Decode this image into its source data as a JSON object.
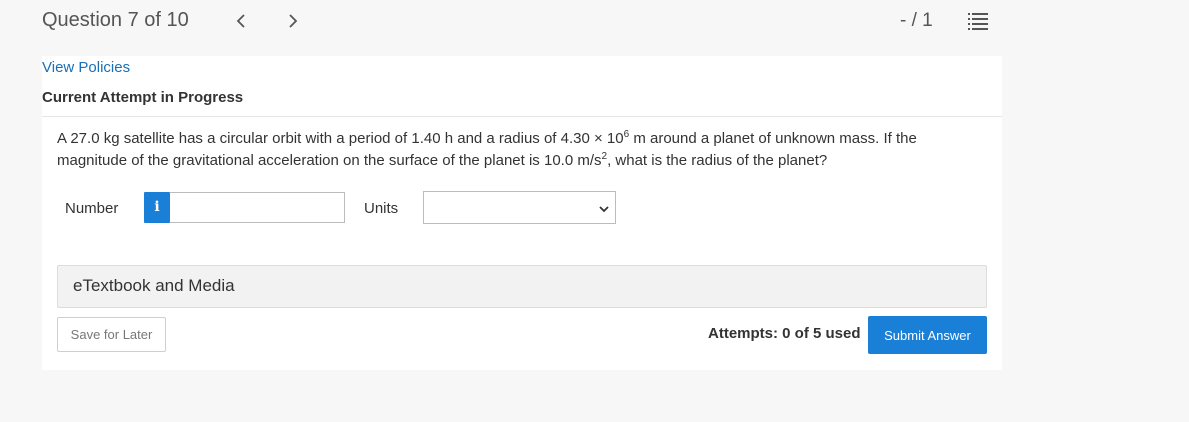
{
  "header": {
    "question_counter": "Question 7 of 10",
    "score": "- / 1",
    "icons": {
      "prev": "chevron-left-icon",
      "next": "chevron-right-icon",
      "list": "question-list-icon"
    }
  },
  "card": {
    "view_policies": "View Policies",
    "attempt_status": "Current Attempt in Progress"
  },
  "question": {
    "line1_part1": "A 27.0 kg satellite has a circular orbit with a period of 1.40 h and a radius of 4.30 × 10",
    "line1_exp": "6",
    "line1_part2": " m around a planet of unknown mass. If the magnitude of the gravitational acceleration on the surface of the planet is 10.0 m/s",
    "line2_exp": "2",
    "line2_part2": ", what is the radius of the planet?"
  },
  "answer": {
    "number_label": "Number",
    "info_glyph": "i",
    "number_value": "",
    "units_label": "Units",
    "units_selected": ""
  },
  "media": {
    "label": "eTextbook and Media"
  },
  "footer": {
    "save_label": "Save for Later",
    "attempts_text": "Attempts: 0 of 5 used",
    "submit_label": "Submit Answer"
  },
  "colors": {
    "accent": "#1a7fd6",
    "link": "#1a6fb5",
    "background": "#f7f7f7"
  }
}
